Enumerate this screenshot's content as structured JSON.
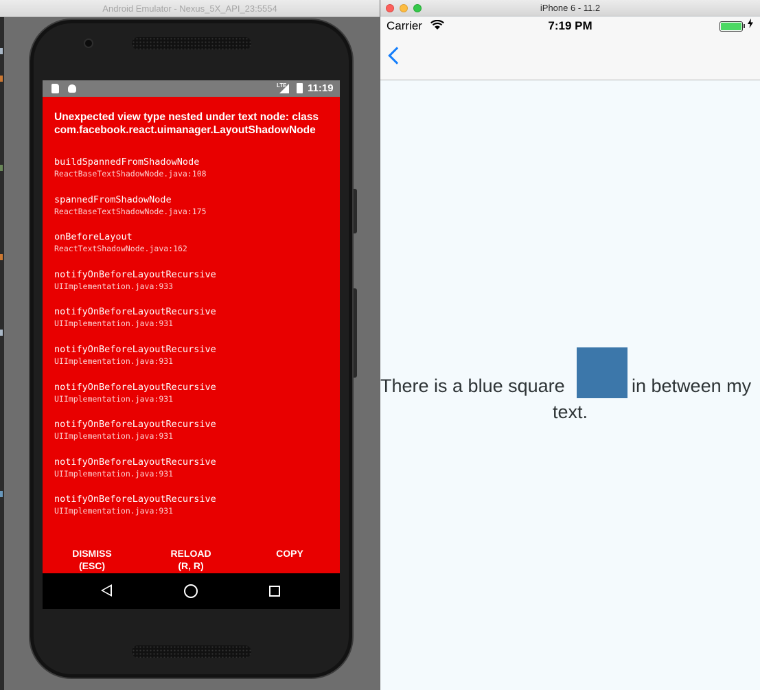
{
  "android_window": {
    "title": "Android Emulator - Nexus_5X_API_23:5554",
    "status_bar": {
      "network": "LTE",
      "time": "11:19"
    },
    "redbox": {
      "title": "Unexpected view type nested under text node: class com.facebook.react.uimanager.LayoutShadowNode",
      "frames": [
        {
          "method": "buildSpannedFromShadowNode",
          "file": "ReactBaseTextShadowNode.java:108"
        },
        {
          "method": "spannedFromShadowNode",
          "file": "ReactBaseTextShadowNode.java:175"
        },
        {
          "method": "onBeforeLayout",
          "file": "ReactTextShadowNode.java:162"
        },
        {
          "method": "notifyOnBeforeLayoutRecursive",
          "file": "UIImplementation.java:933"
        },
        {
          "method": "notifyOnBeforeLayoutRecursive",
          "file": "UIImplementation.java:931"
        },
        {
          "method": "notifyOnBeforeLayoutRecursive",
          "file": "UIImplementation.java:931"
        },
        {
          "method": "notifyOnBeforeLayoutRecursive",
          "file": "UIImplementation.java:931"
        },
        {
          "method": "notifyOnBeforeLayoutRecursive",
          "file": "UIImplementation.java:931"
        },
        {
          "method": "notifyOnBeforeLayoutRecursive",
          "file": "UIImplementation.java:931"
        },
        {
          "method": "notifyOnBeforeLayoutRecursive",
          "file": "UIImplementation.java:931"
        }
      ],
      "buttons": {
        "dismiss_label": "DISMISS",
        "dismiss_shortcut": "(ESC)",
        "reload_label": "RELOAD",
        "reload_shortcut": "(R, R)",
        "copy_label": "COPY"
      },
      "colors": {
        "background": "#e80000"
      }
    },
    "nav_bar": {
      "icons": [
        "back-triangle-icon",
        "home-circle-icon",
        "recents-square-icon"
      ]
    }
  },
  "ios_window": {
    "title": "iPhone 6 - 11.2",
    "status_bar": {
      "carrier": "Carrier",
      "time": "7:19 PM",
      "battery_color": "#4cd964"
    },
    "nav_bar": {
      "back_icon": "chevron-left-icon",
      "tint_color": "#147efb"
    },
    "content": {
      "text_before": "There is a blue square",
      "text_after": "in between my",
      "text_end": "text.",
      "square_color": "#3c77aa"
    }
  }
}
